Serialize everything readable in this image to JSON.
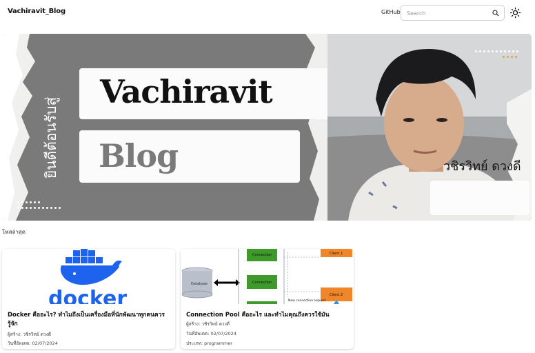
{
  "header": {
    "brand": "Vachiravit_Blog",
    "github_label": "GitHub",
    "search_placeholder": "Search"
  },
  "banner": {
    "welcome_text": "ยินดีต้อนรับสู่",
    "title_line1": "Vachiravit",
    "title_line2": "Blog",
    "author_name": "วชิรวิทย์ ดวงดี"
  },
  "section": {
    "title": "โพสล่าสุด"
  },
  "posts": [
    {
      "image_label": "docker",
      "title": "Docker คืออะไร? ทำไมถึงเป็นเครื่องมือที่นักพัฒนาทุกคนควรรู้จัก",
      "author": "ผู้สร้าง: วชิรวิทย์ ดวงดี",
      "date": "วันที่อัพเดต: 02/07/2024"
    },
    {
      "title": "Connection Pool คืออะไร และทำไมคุณถึงควรใช้มัน",
      "author": "ผู้สร้าง: วชิรวิทย์ ดวงดี",
      "date": "วันที่อัพเดต: 02/07/2024",
      "category": "ประเภท: programmer",
      "diagram": {
        "database": "Database",
        "connection": "Connection",
        "client1": "Client 1",
        "client2": "Client 2",
        "new_request": "New connection request"
      }
    }
  ],
  "colors": {
    "docker_blue": "#1d63ed",
    "diagram_green": "#3e9a2b",
    "diagram_orange": "#f0862a",
    "db_gray": "#b9c0cc"
  }
}
